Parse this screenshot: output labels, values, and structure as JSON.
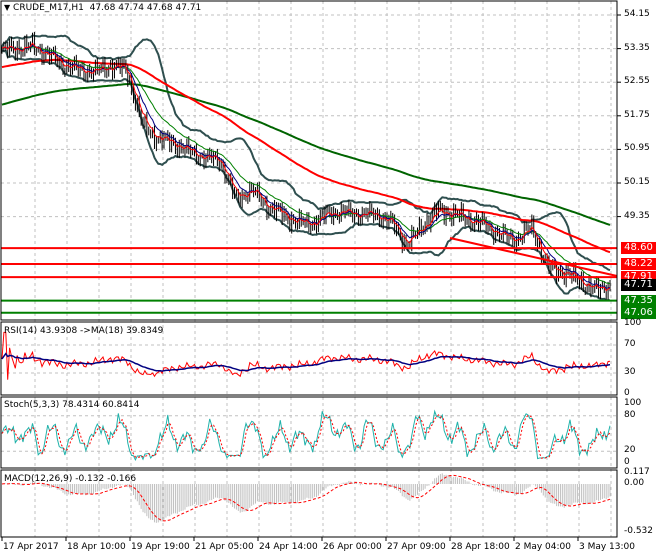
{
  "header": {
    "symbol_label": "CRUDE_M17,H1",
    "ohlc": "47.68 47.74 47.68 47.71",
    "menu_icon": "triangle-down-icon"
  },
  "colors": {
    "bars": "#000000",
    "ma_fast": "#ff0000",
    "ma_mid": "#000080",
    "ma_slow": "#008000",
    "ma_100": "#ff0000",
    "ma_200": "#006400",
    "bollinger": "#2f4f4f",
    "resistance": "#ff0000",
    "support": "#008000",
    "rsi": "#ff0000",
    "rsi_ma": "#000080",
    "stoch_main": "#20b2aa",
    "stoch_signal": "#ff0000",
    "macd_hist": "#c0c0c0",
    "macd_signal": "#ff0000"
  },
  "price_axis": [
    "54.15",
    "53.35",
    "52.55",
    "51.75",
    "50.95",
    "50.15",
    "49.35"
  ],
  "levels": [
    {
      "label": "48.60",
      "value": 48.6,
      "kind": "resistance"
    },
    {
      "label": "48.22",
      "value": 48.22,
      "kind": "resistance"
    },
    {
      "label": "47.91",
      "value": 47.91,
      "kind": "resistance"
    },
    {
      "label": "47.71",
      "value": 47.71,
      "kind": "current"
    },
    {
      "label": "47.35",
      "value": 47.35,
      "kind": "support"
    },
    {
      "label": "47.06",
      "value": 47.06,
      "kind": "support"
    }
  ],
  "rsi": {
    "label": "RSI(14) 43.9308  ->MA(18) 39.8349",
    "axis": [
      "100",
      "70",
      "30",
      "0"
    ]
  },
  "stoch": {
    "label": "Stoch(5,3,3) 78.4314 60.8414",
    "axis": [
      "100",
      "80",
      "20",
      "0"
    ]
  },
  "macd": {
    "label": "MACD(12,26,9) -0.132 -0.166",
    "axis": [
      "0.117",
      "0.00",
      "-0.532"
    ]
  },
  "time_axis": [
    "17 Apr 2017",
    "18 Apr 10:00",
    "19 Apr 19:00",
    "21 Apr 05:00",
    "24 Apr 14:00",
    "26 Apr 00:00",
    "27 Apr 09:00",
    "28 Apr 18:00",
    "2 May 04:00",
    "3 May 13:00"
  ],
  "chart_data": {
    "type": "candlestick",
    "symbol": "CRUDE_M17",
    "timeframe": "H1",
    "ylim": [
      46.95,
      54.35
    ],
    "approx_close_path": [
      53.3,
      53.36,
      53.4,
      53.2,
      52.95,
      52.84,
      52.8,
      52.95,
      52.84,
      51.53,
      51.2,
      51.1,
      50.9,
      50.75,
      50.7,
      49.75,
      50.0,
      49.6,
      49.4,
      49.2,
      49.2,
      49.45,
      49.45,
      49.4,
      49.4,
      49.2,
      48.67,
      49.15,
      49.5,
      49.4,
      49.27,
      49.15,
      48.9,
      48.8,
      49.1,
      48.13,
      48.03,
      47.84,
      47.6,
      47.71
    ],
    "last_ohlc": {
      "open": 47.68,
      "high": 47.74,
      "low": 47.68,
      "close": 47.71
    }
  }
}
